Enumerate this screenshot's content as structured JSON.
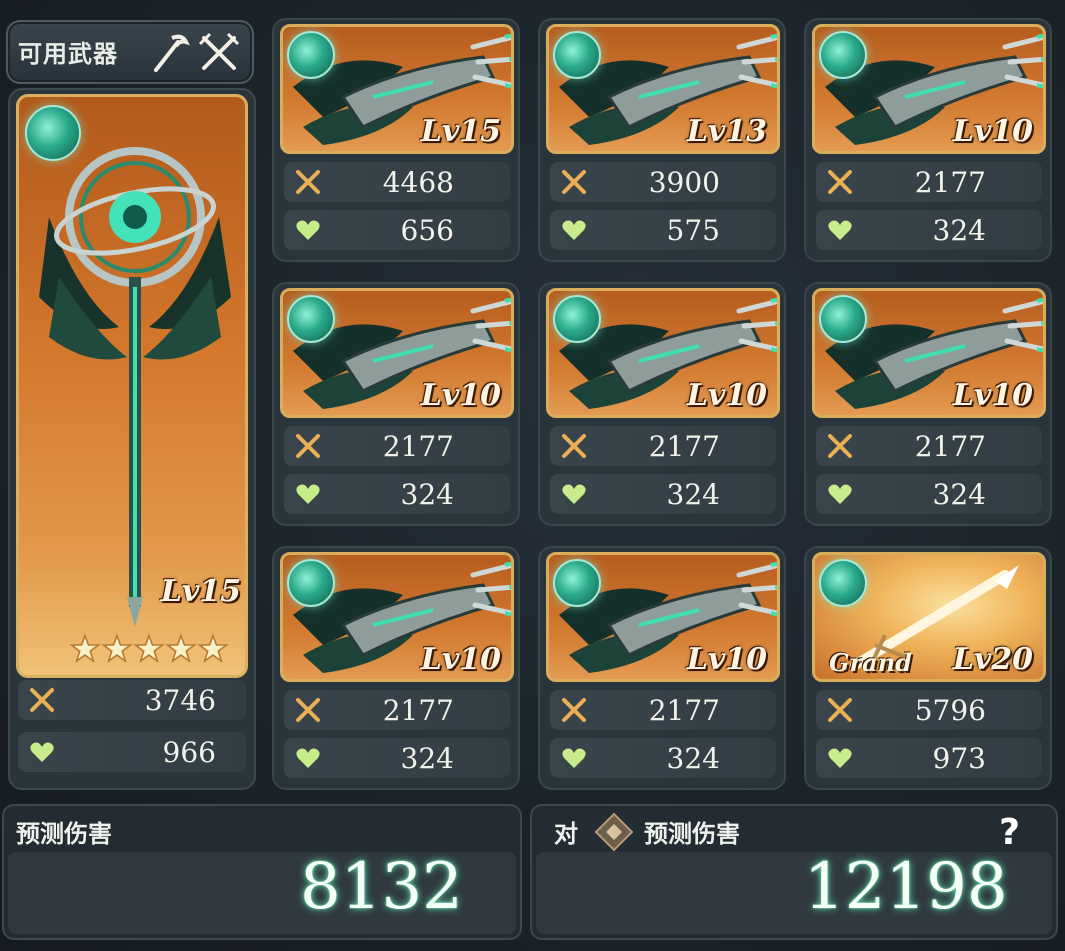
{
  "header": {
    "tab_label": "可用武器"
  },
  "main_weapon": {
    "level": "Lv15",
    "stars": 5,
    "attack": "3746",
    "hp": "966",
    "element": "wind-element-icon"
  },
  "weapons": [
    {
      "level": "Lv15",
      "attack": "4468",
      "hp": "656",
      "type": "claw"
    },
    {
      "level": "Lv13",
      "attack": "3900",
      "hp": "575",
      "type": "claw"
    },
    {
      "level": "Lv10",
      "attack": "2177",
      "hp": "324",
      "type": "claw"
    },
    {
      "level": "Lv10",
      "attack": "2177",
      "hp": "324",
      "type": "claw"
    },
    {
      "level": "Lv10",
      "attack": "2177",
      "hp": "324",
      "type": "claw"
    },
    {
      "level": "Lv10",
      "attack": "2177",
      "hp": "324",
      "type": "claw"
    },
    {
      "level": "Lv10",
      "attack": "2177",
      "hp": "324",
      "type": "claw"
    },
    {
      "level": "Lv10",
      "attack": "2177",
      "hp": "324",
      "type": "claw"
    },
    {
      "level": "Lv20",
      "attack": "5796",
      "hp": "973",
      "type": "spear",
      "tag": "Grand"
    }
  ],
  "predicted": {
    "label": "预测伤害",
    "value": "8132"
  },
  "predicted_vs": {
    "prefix": "对",
    "label": "预测伤害",
    "value": "12198",
    "help": "?"
  },
  "colors": {
    "accent_green": "#6ae6b8",
    "card_gold": "#d8ad5c",
    "card_orange": "#d27a30"
  }
}
